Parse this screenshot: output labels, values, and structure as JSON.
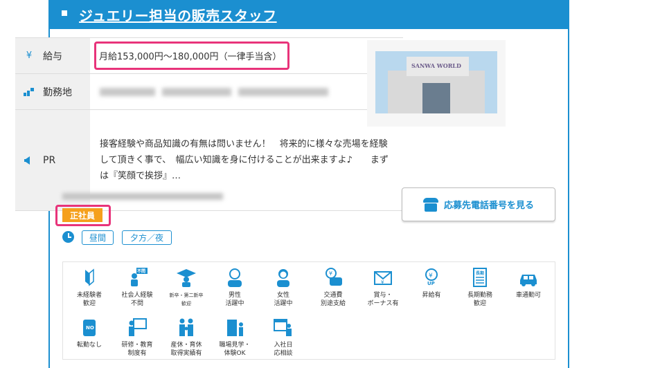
{
  "header": {
    "title": "ジュエリー担当の販売スタッフ"
  },
  "table": {
    "salary": {
      "label": "給与",
      "icon": "yen-icon",
      "value": "月給153,000円〜180,000円（一律手当含）"
    },
    "location": {
      "label": "勤務地",
      "icon": "location-icon"
    },
    "pr": {
      "label": "PR",
      "icon": "megaphone-icon",
      "value": "接客経験や商品知識の有無は問いません！　将来的に様々な売場を経験して頂きく事で、　幅広い知識を身に付けることが出来ますよ♪　　まずは『笑顔で挨拶』…"
    }
  },
  "photo": {
    "sign": "SANWA WORLD"
  },
  "employment_badge": "正社員",
  "time_slots": [
    "昼間",
    "夕方／夜"
  ],
  "phone_button": {
    "label": "応募先電話番号を見る",
    "icon": "telephone-icon"
  },
  "features": [
    {
      "label": "未経験者\n歓迎",
      "icon": "beginner-mark-icon"
    },
    {
      "label": "社会人経験\n不問",
      "icon": "no-experience-person-icon",
      "tag": "不問"
    },
    {
      "label": "新卒・第二新卒\n歓迎",
      "icon": "graduate-cap-icon"
    },
    {
      "label": "男性\n活躍中",
      "icon": "male-person-icon"
    },
    {
      "label": "女性\n活躍中",
      "icon": "female-person-icon"
    },
    {
      "label": "交通費\n別途支給",
      "icon": "train-yen-icon"
    },
    {
      "label": "賞与・\nボーナス有",
      "icon": "bonus-envelope-icon"
    },
    {
      "label": "昇給有",
      "icon": "yen-up-icon",
      "tag": "UP"
    },
    {
      "label": "長期勤務\n歓迎",
      "icon": "calendar-long-icon",
      "tag": "長期"
    },
    {
      "label": "車通勤可",
      "icon": "car-icon"
    },
    {
      "label": "転勤なし",
      "icon": "suitcase-no-icon",
      "tag": "NO"
    },
    {
      "label": "研修・教育\n制度有",
      "icon": "training-board-icon"
    },
    {
      "label": "産休・育休\n取得実績有",
      "icon": "family-icon"
    },
    {
      "label": "職場見学・\n体験OK",
      "icon": "building-visit-icon"
    },
    {
      "label": "入社日\n応相談",
      "icon": "calendar-person-icon"
    }
  ],
  "colors": {
    "accent": "#1b8fd0",
    "highlight": "#e8337a",
    "badge": "#f5a01c"
  }
}
